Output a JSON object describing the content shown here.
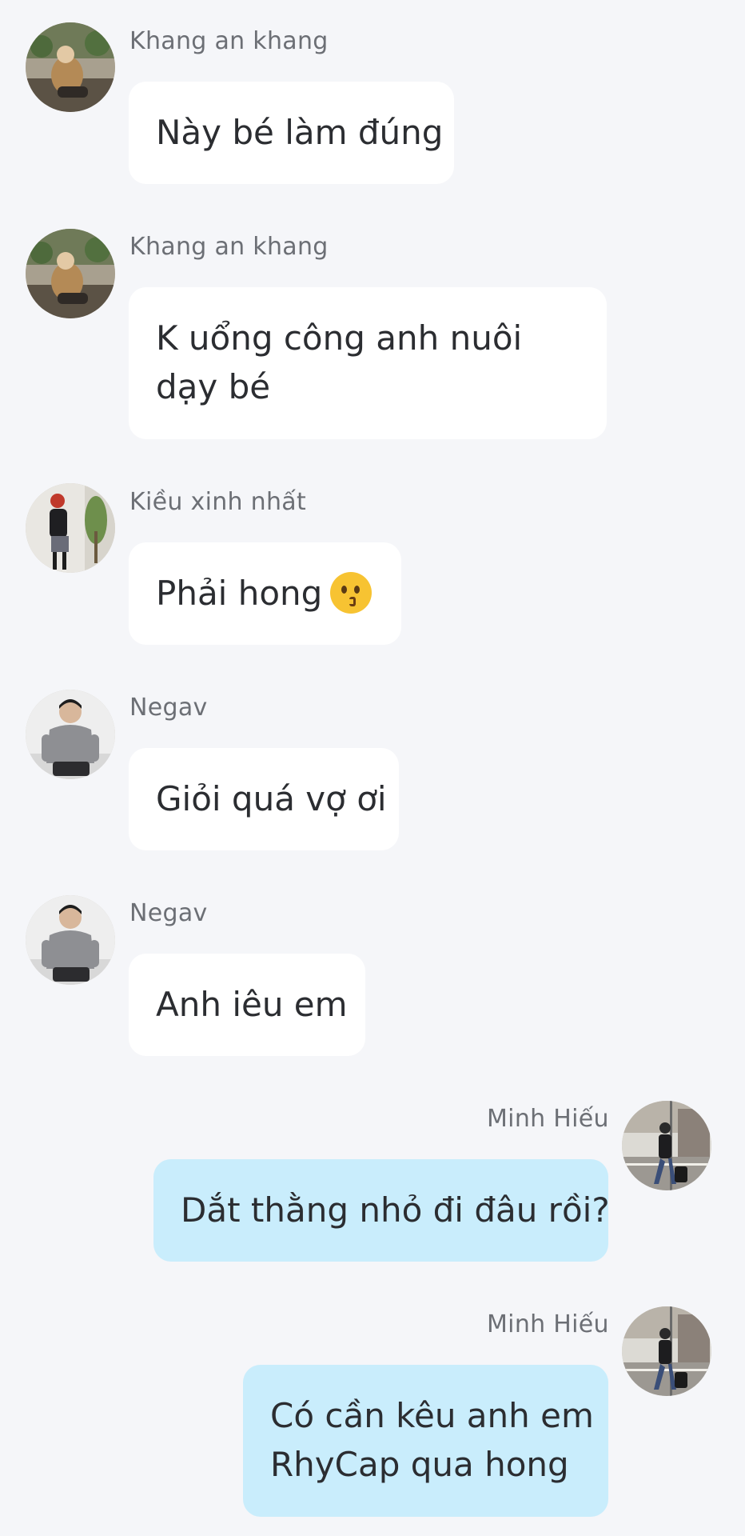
{
  "messages": [
    {
      "sender": "Khang an khang",
      "lines": [
        "Này bé làm đúng"
      ],
      "direction": "incoming",
      "avatar": "avatar-khang"
    },
    {
      "sender": "Khang an khang",
      "lines": [
        "K uổng công anh nuôi",
        "dạy bé"
      ],
      "direction": "incoming",
      "avatar": "avatar-khang"
    },
    {
      "sender": "Kiều xinh nhất",
      "lines": [
        "Phải hong"
      ],
      "emoji": "kissing-face",
      "direction": "incoming",
      "avatar": "avatar-kieu"
    },
    {
      "sender": "Negav",
      "lines": [
        "Giỏi quá vợ ơi"
      ],
      "direction": "incoming",
      "avatar": "avatar-negav"
    },
    {
      "sender": "Negav",
      "lines": [
        "Anh iêu em"
      ],
      "direction": "incoming",
      "avatar": "avatar-negav"
    },
    {
      "sender": "Minh Hiếu",
      "lines": [
        "Dắt thằng nhỏ đi đâu rồi?"
      ],
      "direction": "outgoing",
      "avatar": "avatar-minhhieu"
    },
    {
      "sender": "Minh Hiếu",
      "lines": [
        "Có cần kêu anh em",
        "RhyCap qua hong"
      ],
      "direction": "outgoing",
      "avatar": "avatar-minhhieu"
    }
  ],
  "colors": {
    "background": "#f5f6f9",
    "incoming_bubble": "#ffffff",
    "outgoing_bubble": "#c9edfc",
    "sender_text": "#6c6f75",
    "message_text": "#2b2d31"
  }
}
